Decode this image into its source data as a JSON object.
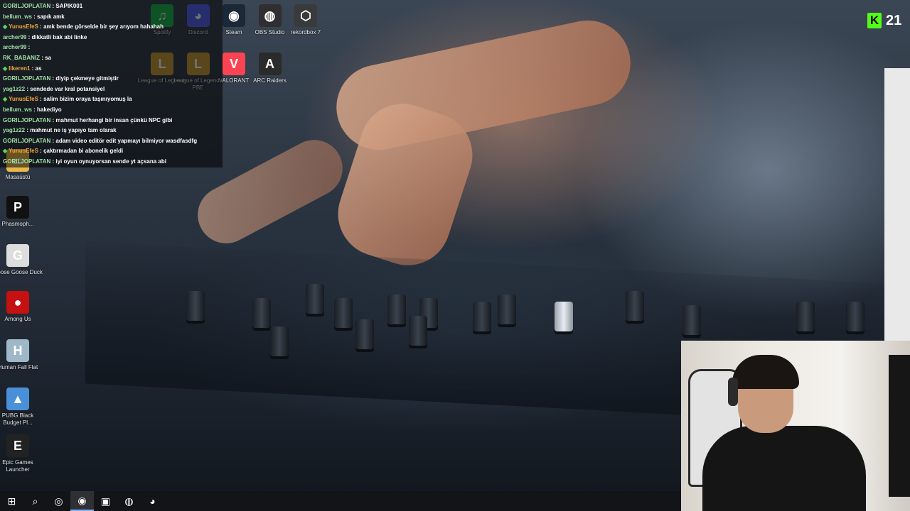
{
  "chat": [
    {
      "user": "GORILJOPLATAN",
      "msg": "SAPIK001",
      "vip": false,
      "badge": false
    },
    {
      "user": "bellum_ws",
      "msg": "sapık amk",
      "vip": false,
      "badge": false
    },
    {
      "user": "YunusEfeS",
      "msg": "amk bende görselde bir şey arıyom hahahah",
      "vip": true,
      "badge": true
    },
    {
      "user": "archer99",
      "msg": "dikkatli bak abi linke",
      "vip": false,
      "badge": false
    },
    {
      "user": "archer99",
      "msg": "",
      "vip": false,
      "badge": false
    },
    {
      "user": "RK_BABANIZ",
      "msg": "sa",
      "vip": false,
      "badge": false
    },
    {
      "user": "Ilkeren1",
      "msg": "as",
      "vip": true,
      "badge": true
    },
    {
      "user": "GORILJOPLATAN",
      "msg": "diyip çekmeye gitmiştir",
      "vip": false,
      "badge": false
    },
    {
      "user": "yag1z22",
      "msg": "sendede var kral potansiyel",
      "vip": false,
      "badge": false
    },
    {
      "user": "YunusEfeS",
      "msg": "salim bizim oraya taşınıyomuş la",
      "vip": true,
      "badge": true
    },
    {
      "user": "bellum_ws",
      "msg": "hakediyo",
      "vip": false,
      "badge": false
    },
    {
      "user": "GORILJOPLATAN",
      "msg": "mahmut herhangi bir insan çünkü NPC gibi",
      "vip": false,
      "badge": false
    },
    {
      "user": "yag1z22",
      "msg": "mahmut ne iş yapıyo tam olarak",
      "vip": false,
      "badge": false
    },
    {
      "user": "GORILJOPLATAN",
      "msg": "adam video editör edit yapmayı bilmiyor wasdfasdfg",
      "vip": false,
      "badge": false
    },
    {
      "user": "YunusEfeS",
      "msg": "çaktırmadan bi abonelik geldi",
      "vip": true,
      "badge": true
    },
    {
      "user": "GORILJOPLATAN",
      "msg": "iyi oyun oynuyorsan sende yt açsana abi",
      "vip": false,
      "badge": false
    }
  ],
  "desktop_icons_top": [
    {
      "label": "Spotify",
      "icon": "spotify-icon",
      "color": "#1db954",
      "glyph": "♫"
    },
    {
      "label": "Discord",
      "icon": "discord-icon",
      "color": "#5865f2",
      "glyph": "◕"
    },
    {
      "label": "Steam",
      "icon": "steam-icon",
      "color": "#1b2838",
      "glyph": "◉"
    },
    {
      "label": "OBS Studio",
      "icon": "obs-icon",
      "color": "#302e31",
      "glyph": "◍"
    },
    {
      "label": "rekordbox 7",
      "icon": "rekordbox-icon",
      "color": "#3a3a3a",
      "glyph": "⬡"
    }
  ],
  "desktop_icons_row2": [
    {
      "label": "League of Legends",
      "icon": "league-icon",
      "color": "#c89b3c",
      "glyph": "L"
    },
    {
      "label": "League of Legends PBE",
      "icon": "league-pbe-icon",
      "color": "#c89b3c",
      "glyph": "L"
    },
    {
      "label": "VALORANT",
      "icon": "valorant-icon",
      "color": "#fa4454",
      "glyph": "V"
    },
    {
      "label": "ARC Raiders",
      "icon": "arc-raiders-icon",
      "color": "#2b2b2b",
      "glyph": "A"
    }
  ],
  "desktop_icons_left": [
    {
      "label": "Masaüstü",
      "icon": "folder-icon",
      "color": "#e8b84a",
      "glyph": "▭"
    },
    {
      "label": "Phasmoph...",
      "icon": "phasmophobia-icon",
      "color": "#111",
      "glyph": "P"
    },
    {
      "label": "Goose Goose Duck",
      "icon": "goose-icon",
      "color": "#ddd",
      "glyph": "G"
    },
    {
      "label": "Among Us",
      "icon": "among-us-icon",
      "color": "#c51111",
      "glyph": "●"
    },
    {
      "label": "Human Fall Flat",
      "icon": "human-fall-flat-icon",
      "color": "#9fb7c9",
      "glyph": "H"
    },
    {
      "label": "PUBG Black Budget Pl...",
      "icon": "pubg-icon",
      "color": "#4a90d9",
      "glyph": "▲"
    },
    {
      "label": "Epic Games Launcher",
      "icon": "epic-games-icon",
      "color": "#222",
      "glyph": "E"
    }
  ],
  "kick": {
    "count": "21",
    "logo": "K"
  },
  "taskbar": [
    {
      "name": "start-icon",
      "glyph": "⊞"
    },
    {
      "name": "search-icon",
      "glyph": "⌕"
    },
    {
      "name": "app-icon-red",
      "glyph": "◎"
    },
    {
      "name": "chrome-icon",
      "glyph": "◉"
    },
    {
      "name": "ctrl-icon",
      "glyph": "▣"
    },
    {
      "name": "obs-taskbar-icon",
      "glyph": "◍"
    },
    {
      "name": "discord-taskbar-icon",
      "glyph": "◕"
    }
  ]
}
